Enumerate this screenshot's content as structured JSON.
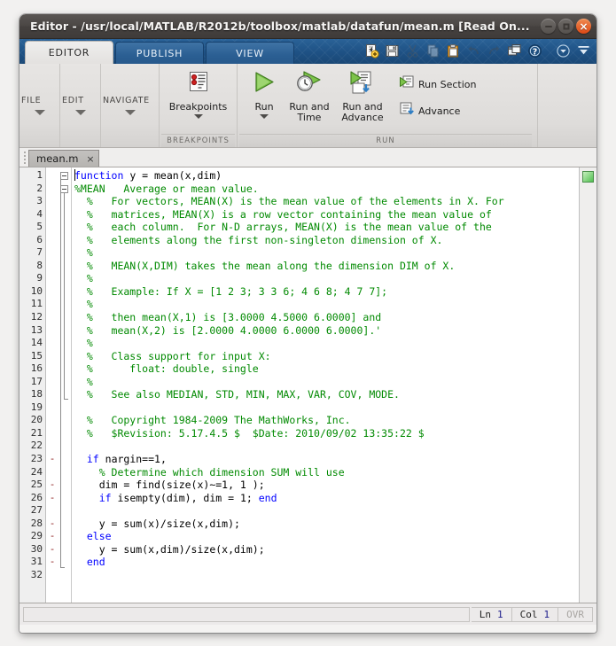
{
  "window": {
    "title": "Editor - /usr/local/MATLAB/R2012b/toolbox/matlab/datafun/mean.m [Read On...",
    "minimize_label": "–",
    "maximize_label": "□",
    "close_label": "×"
  },
  "ribbon": {
    "tabs": [
      {
        "label": "EDITOR",
        "active": true
      },
      {
        "label": "PUBLISH",
        "active": false
      },
      {
        "label": "VIEW",
        "active": false
      }
    ],
    "quick_access": [
      {
        "name": "new-file-icon",
        "title": "New"
      },
      {
        "name": "save-icon",
        "title": "Save"
      },
      {
        "name": "cut-icon",
        "title": "Cut",
        "disabled": true
      },
      {
        "name": "copy-icon",
        "title": "Copy",
        "disabled": true
      },
      {
        "name": "paste-icon",
        "title": "Paste"
      },
      {
        "name": "undo-icon",
        "title": "Undo",
        "disabled": true
      },
      {
        "name": "redo-icon",
        "title": "Redo",
        "disabled": true
      },
      {
        "name": "switch-window-icon",
        "title": "Switch Window"
      },
      {
        "name": "help-icon",
        "title": "Help"
      }
    ],
    "qat_dropdown": "▼",
    "qat_minimize": "▲",
    "collapsed_groups": [
      {
        "label": "FILE"
      },
      {
        "label": "EDIT"
      },
      {
        "label": "NAVIGATE"
      }
    ],
    "groups": [
      {
        "footer": "BREAKPOINTS",
        "buttons": [
          {
            "label": "Breakpoints",
            "icon": "breakpoints-icon",
            "type": "big",
            "has_arrow": true
          }
        ]
      },
      {
        "footer": "RUN",
        "buttons": [
          {
            "label": "Run",
            "icon": "run-icon",
            "type": "big",
            "has_arrow": true
          },
          {
            "label": "Run and\nTime",
            "icon": "run-and-time-icon",
            "type": "big",
            "has_arrow": false
          },
          {
            "label": "Run and\nAdvance",
            "icon": "run-and-advance-icon",
            "type": "big",
            "has_arrow": false
          },
          {
            "label": "Run Section",
            "icon": "run-section-icon",
            "type": "small"
          },
          {
            "label": "Advance",
            "icon": "advance-icon",
            "type": "small"
          }
        ]
      }
    ]
  },
  "document_tabs": [
    {
      "label": "mean.m",
      "close": "×",
      "active": true
    }
  ],
  "editor": {
    "line_numbers": [
      1,
      2,
      3,
      4,
      5,
      6,
      7,
      8,
      9,
      10,
      11,
      12,
      13,
      14,
      15,
      16,
      17,
      18,
      19,
      20,
      21,
      22,
      23,
      24,
      25,
      26,
      27,
      28,
      29,
      30,
      31,
      32
    ],
    "breakpoint_marks": {
      "23": "-",
      "25": "-",
      "26": "-",
      "28": "-",
      "29": "-",
      "30": "-",
      "31": "-"
    },
    "lines": [
      {
        "n": 1,
        "segments": [
          {
            "t": "function",
            "c": "kw"
          },
          {
            "t": " y = mean(x,dim)",
            "c": ""
          }
        ]
      },
      {
        "n": 2,
        "segments": [
          {
            "t": "%MEAN   Average or mean value.",
            "c": "cm"
          }
        ]
      },
      {
        "n": 3,
        "segments": [
          {
            "t": "  %   For vectors, MEAN(X) is the mean value of the elements in X. For",
            "c": "cm"
          }
        ]
      },
      {
        "n": 4,
        "segments": [
          {
            "t": "  %   matrices, MEAN(X) is a row vector containing the mean value of",
            "c": "cm"
          }
        ]
      },
      {
        "n": 5,
        "segments": [
          {
            "t": "  %   each column.  For N-D arrays, MEAN(X) is the mean value of the",
            "c": "cm"
          }
        ]
      },
      {
        "n": 6,
        "segments": [
          {
            "t": "  %   elements along the first non-singleton dimension of X.",
            "c": "cm"
          }
        ]
      },
      {
        "n": 7,
        "segments": [
          {
            "t": "  %",
            "c": "cm"
          }
        ]
      },
      {
        "n": 8,
        "segments": [
          {
            "t": "  %   MEAN(X,DIM) takes the mean along the dimension DIM of X.",
            "c": "cm"
          }
        ]
      },
      {
        "n": 9,
        "segments": [
          {
            "t": "  %",
            "c": "cm"
          }
        ]
      },
      {
        "n": 10,
        "segments": [
          {
            "t": "  %   Example: If X = [1 2 3; 3 3 6; 4 6 8; 4 7 7];",
            "c": "cm"
          }
        ]
      },
      {
        "n": 11,
        "segments": [
          {
            "t": "  %",
            "c": "cm"
          }
        ]
      },
      {
        "n": 12,
        "segments": [
          {
            "t": "  %   then mean(X,1) is [3.0000 4.5000 6.0000] and",
            "c": "cm"
          }
        ]
      },
      {
        "n": 13,
        "segments": [
          {
            "t": "  %   mean(X,2) is [2.0000 4.0000 6.0000 6.0000].'",
            "c": "cm"
          }
        ]
      },
      {
        "n": 14,
        "segments": [
          {
            "t": "  %",
            "c": "cm"
          }
        ]
      },
      {
        "n": 15,
        "segments": [
          {
            "t": "  %   Class support for input X:",
            "c": "cm"
          }
        ]
      },
      {
        "n": 16,
        "segments": [
          {
            "t": "  %      float: double, single",
            "c": "cm"
          }
        ]
      },
      {
        "n": 17,
        "segments": [
          {
            "t": "  %",
            "c": "cm"
          }
        ]
      },
      {
        "n": 18,
        "segments": [
          {
            "t": "  %   See also MEDIAN, STD, MIN, MAX, VAR, COV, MODE.",
            "c": "cm"
          }
        ]
      },
      {
        "n": 19,
        "segments": [
          {
            "t": "",
            "c": ""
          }
        ]
      },
      {
        "n": 20,
        "segments": [
          {
            "t": "  %   Copyright 1984-2009 The MathWorks, Inc.",
            "c": "cm"
          }
        ]
      },
      {
        "n": 21,
        "segments": [
          {
            "t": "  %   $Revision: 5.17.4.5 $  $Date: 2010/09/02 13:35:22 $",
            "c": "cm"
          }
        ]
      },
      {
        "n": 22,
        "segments": [
          {
            "t": "",
            "c": ""
          }
        ]
      },
      {
        "n": 23,
        "segments": [
          {
            "t": "  ",
            "c": ""
          },
          {
            "t": "if",
            "c": "kw"
          },
          {
            "t": " nargin==1,",
            "c": ""
          }
        ]
      },
      {
        "n": 24,
        "segments": [
          {
            "t": "    % Determine which dimension SUM will use",
            "c": "cm"
          }
        ]
      },
      {
        "n": 25,
        "segments": [
          {
            "t": "    dim = find(size(x)~=1, 1 );",
            "c": ""
          }
        ]
      },
      {
        "n": 26,
        "segments": [
          {
            "t": "    ",
            "c": ""
          },
          {
            "t": "if",
            "c": "kw"
          },
          {
            "t": " isempty(dim), dim = 1; ",
            "c": ""
          },
          {
            "t": "end",
            "c": "kw"
          }
        ]
      },
      {
        "n": 27,
        "segments": [
          {
            "t": "",
            "c": ""
          }
        ]
      },
      {
        "n": 28,
        "segments": [
          {
            "t": "    y = sum(x)/size(x,dim);",
            "c": ""
          }
        ]
      },
      {
        "n": 29,
        "segments": [
          {
            "t": "  ",
            "c": ""
          },
          {
            "t": "else",
            "c": "kw"
          }
        ]
      },
      {
        "n": 30,
        "segments": [
          {
            "t": "    y = sum(x,dim)/size(x,dim);",
            "c": ""
          }
        ]
      },
      {
        "n": 31,
        "segments": [
          {
            "t": "  ",
            "c": ""
          },
          {
            "t": "end",
            "c": "kw"
          }
        ]
      },
      {
        "n": 32,
        "segments": [
          {
            "t": "",
            "c": ""
          }
        ]
      }
    ],
    "analyzer_status": "ok"
  },
  "status_bar": {
    "line_label": "Ln",
    "line_value": "1",
    "col_label": "Col",
    "col_value": "1",
    "overwrite_label": "OVR"
  },
  "colors": {
    "keyword": "#0000ff",
    "comment": "#028a02",
    "ribbon_blue": "#1e5184",
    "title_bar": "#4b4745",
    "close_button": "#dd4814",
    "analyzer_ok": "#4fbf4f"
  }
}
